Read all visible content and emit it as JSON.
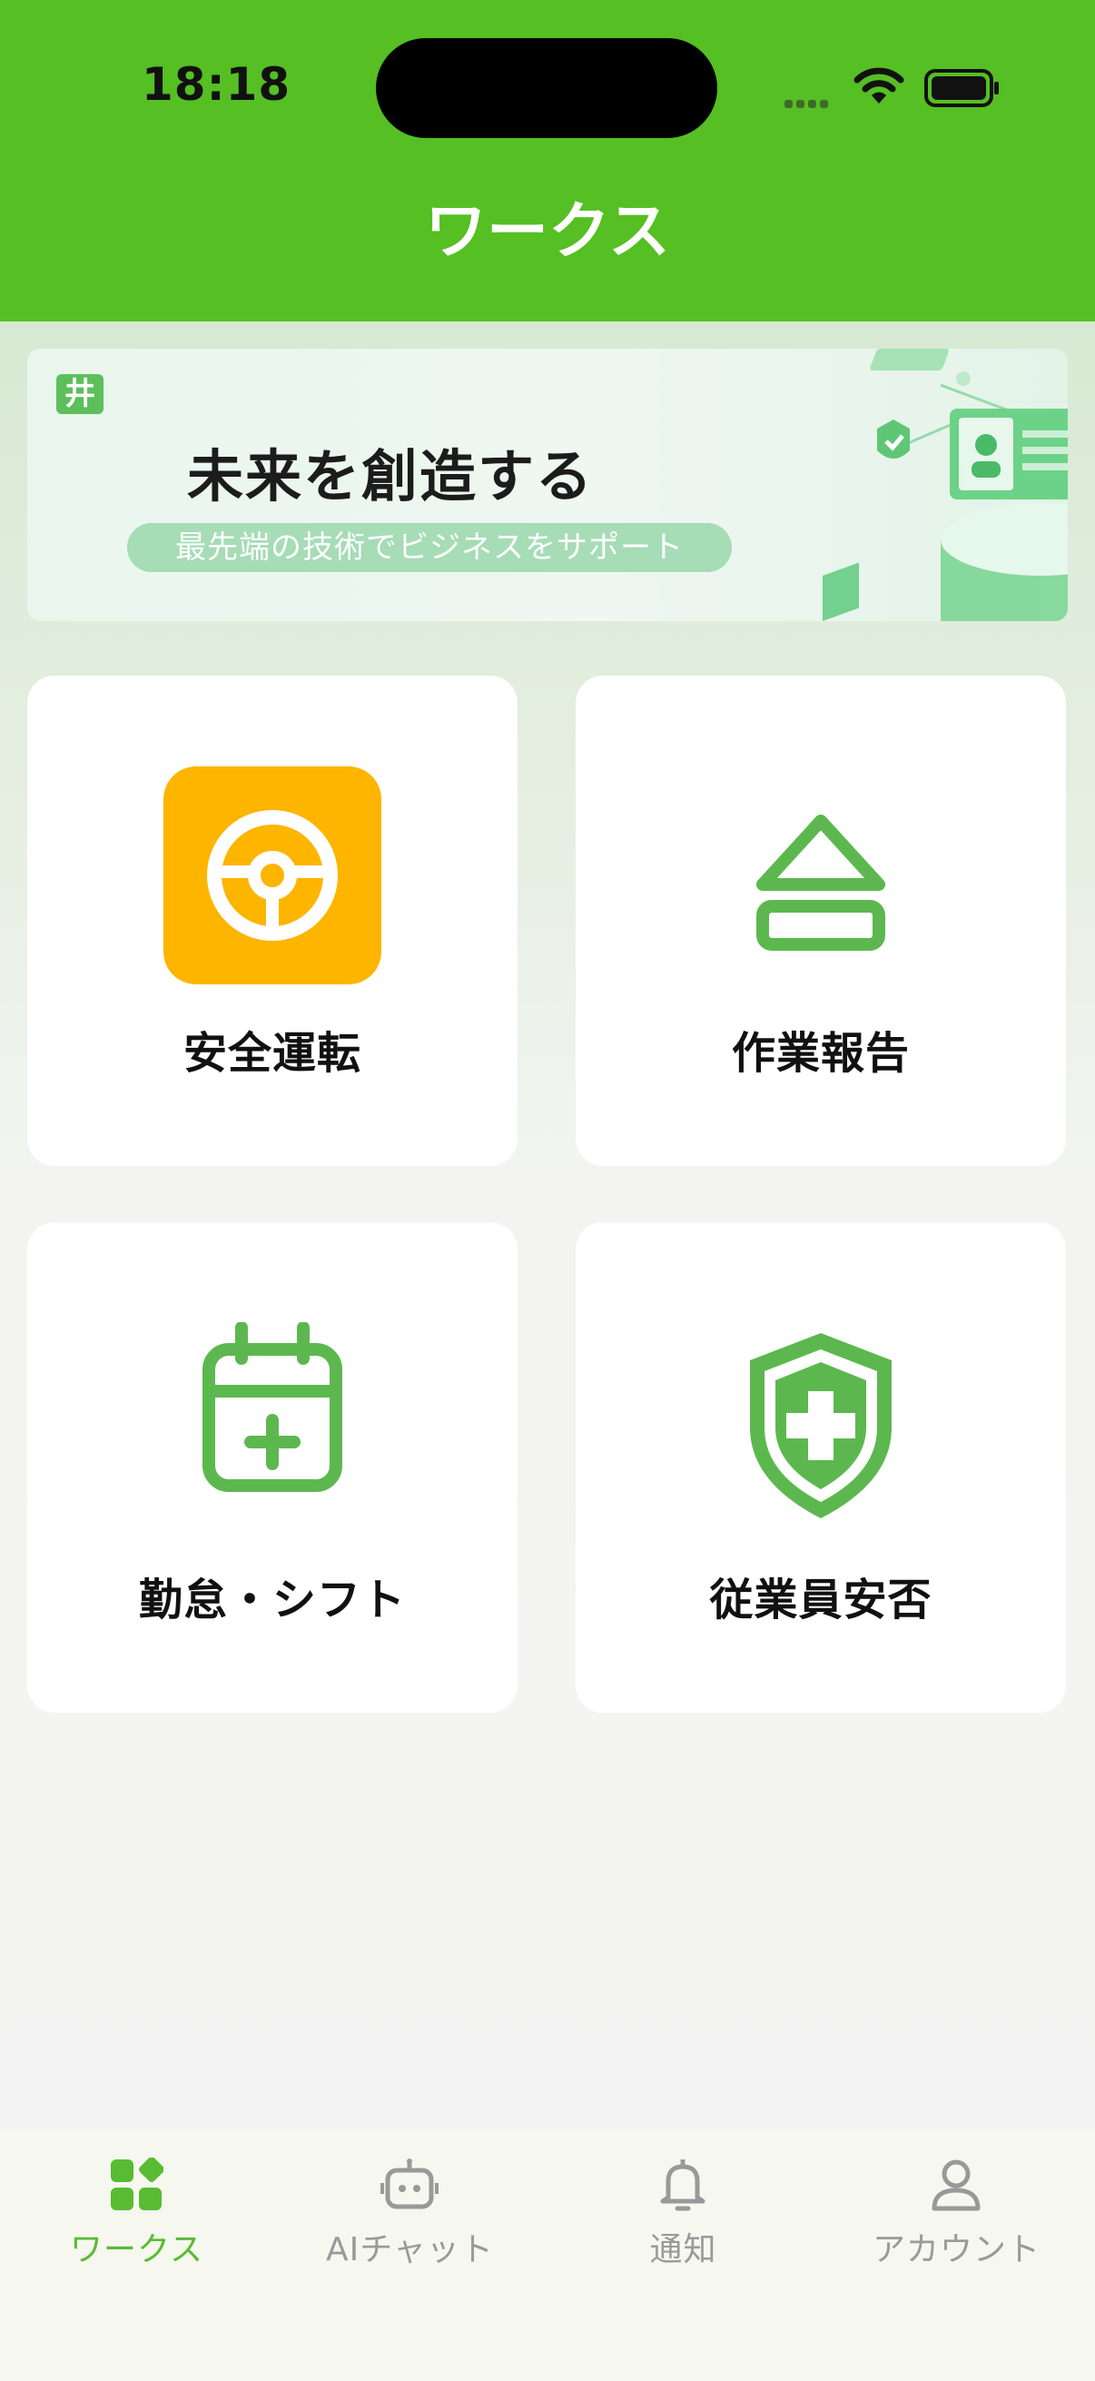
{
  "status_bar": {
    "time": "18:18"
  },
  "header": {
    "title": "ワークス"
  },
  "banner": {
    "logo_text": "井",
    "title": "未来を創造する",
    "subtitle": "最先端の技術でビジネスをサポート"
  },
  "menu": {
    "items": [
      {
        "label": "安全運転",
        "icon": "steering-wheel-icon"
      },
      {
        "label": "作業報告",
        "icon": "eject-icon"
      },
      {
        "label": "勤怠・シフト",
        "icon": "calendar-add-icon"
      },
      {
        "label": "従業員安否",
        "icon": "shield-plus-icon"
      }
    ]
  },
  "tabbar": {
    "items": [
      {
        "label": "ワークス",
        "icon": "apps-icon",
        "active": true
      },
      {
        "label": "AIチャット",
        "icon": "robot-icon",
        "active": false
      },
      {
        "label": "通知",
        "icon": "bell-icon",
        "active": false
      },
      {
        "label": "アカウント",
        "icon": "user-icon",
        "active": false
      }
    ]
  },
  "colors": {
    "brand_green": "#55bf23",
    "icon_green": "#5cb84e",
    "accent_orange": "#fdb500",
    "inactive_gray": "#9a9a9a"
  }
}
